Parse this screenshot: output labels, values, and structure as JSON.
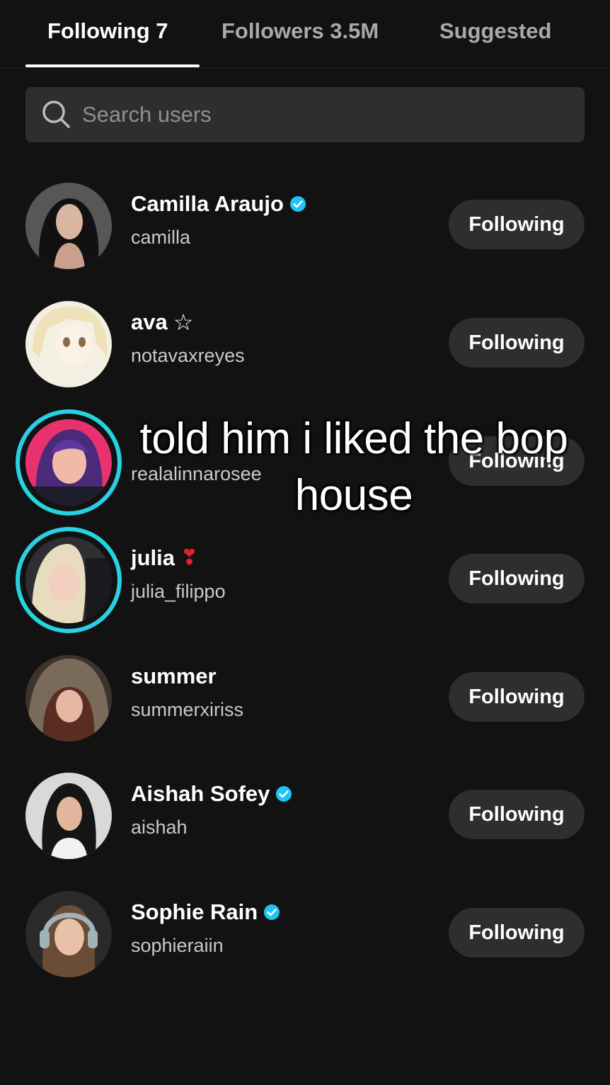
{
  "tabs": {
    "following": "Following 7",
    "followers": "Followers 3.5M",
    "suggested": "Suggested"
  },
  "search": {
    "placeholder": "Search users"
  },
  "users": [
    {
      "name": "Camilla Araujo",
      "username": "camilla",
      "verified": true,
      "button": "Following",
      "story_ring": false
    },
    {
      "name": "ava",
      "badge": "☆",
      "username": "notavaxreyes",
      "verified": false,
      "button": "Following",
      "story_ring": false
    },
    {
      "name": "",
      "username": "realalinnarosee",
      "verified": false,
      "button": "Following",
      "story_ring": true
    },
    {
      "name": "julia",
      "badge": "❣",
      "username": "julia_filippo",
      "verified": false,
      "button": "Following",
      "story_ring": true
    },
    {
      "name": "summer",
      "username": "summerxiriss",
      "verified": false,
      "button": "Following",
      "story_ring": false
    },
    {
      "name": "Aishah Sofey",
      "username": "aishah",
      "verified": true,
      "button": "Following",
      "story_ring": false
    },
    {
      "name": "Sophie Rain",
      "username": "sophieraiin",
      "verified": true,
      "button": "Following",
      "story_ring": false
    }
  ],
  "caption": "told him i liked the bop house",
  "colors": {
    "background": "#121212",
    "verified": "#20c4f4",
    "story_ring": "#33c8ef",
    "button_bg": "#2e2e2e"
  }
}
